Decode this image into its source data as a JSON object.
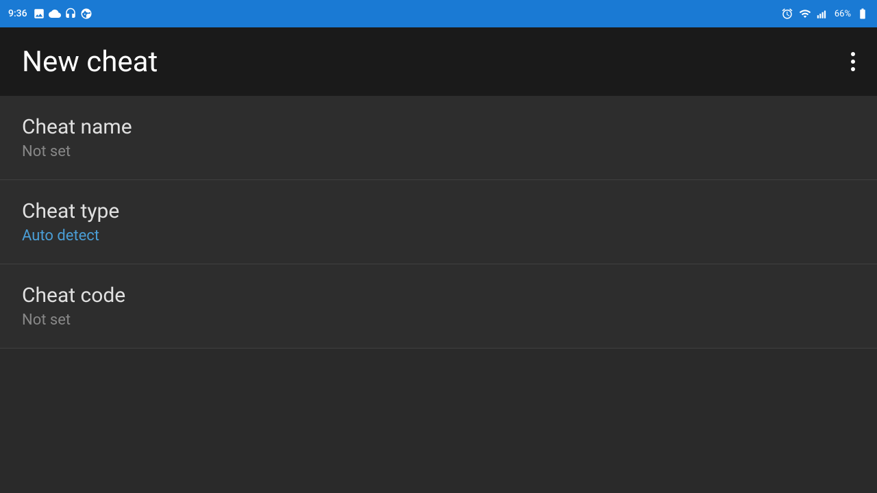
{
  "statusBar": {
    "time": "9:36",
    "batteryPercent": "66%",
    "icons": [
      "image-icon",
      "cloud-icon",
      "headset-icon",
      "face-icon"
    ]
  },
  "appBar": {
    "title": "New cheat",
    "moreIconLabel": "⋮"
  },
  "listItems": [
    {
      "id": "cheat-name",
      "title": "Cheat name",
      "subtitle": "Not set",
      "subtitleStyle": "muted"
    },
    {
      "id": "cheat-type",
      "title": "Cheat type",
      "subtitle": "Auto detect",
      "subtitleStyle": "accent"
    },
    {
      "id": "cheat-code",
      "title": "Cheat code",
      "subtitle": "Not set",
      "subtitleStyle": "muted"
    }
  ]
}
